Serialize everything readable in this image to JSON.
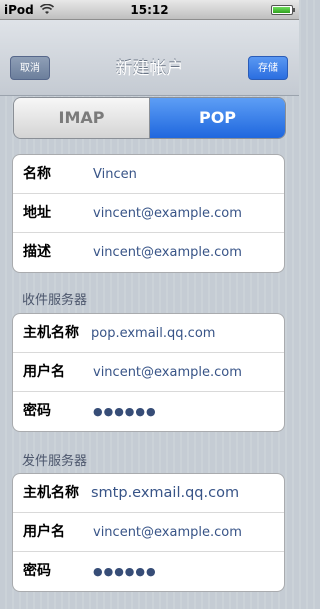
{
  "status": {
    "carrier": "iPod",
    "time": "15:12"
  },
  "nav": {
    "cancel_label": "取消",
    "title": "新建帐户",
    "save_label": "存储"
  },
  "segmented": {
    "options": [
      "IMAP",
      "POP"
    ],
    "selected": "POP"
  },
  "account": {
    "rows": [
      {
        "label": "名称",
        "value": "Vincen"
      },
      {
        "label": "地址",
        "value": "vincent@example.com"
      },
      {
        "label": "描述",
        "value": "vincent@example.com"
      }
    ]
  },
  "incoming": {
    "header": "收件服务器",
    "rows": [
      {
        "label": "主机名称",
        "value": "pop.exmail.qq.com"
      },
      {
        "label": "用户名",
        "value": "vincent@example.com"
      },
      {
        "label": "密码",
        "value": "●●●●●●"
      }
    ]
  },
  "outgoing": {
    "header": "发件服务器",
    "rows": [
      {
        "label": "主机名称",
        "value": "smtp.exmail.qq.com"
      },
      {
        "label": "用户名",
        "value": "vincent@example.com"
      },
      {
        "label": "密码",
        "value": "●●●●●●"
      }
    ]
  },
  "colors": {
    "accent": "#2b6ee0",
    "value_text": "#385487"
  }
}
